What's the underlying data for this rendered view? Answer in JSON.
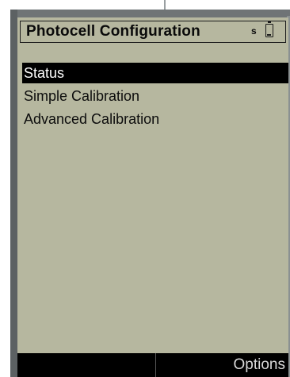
{
  "header": {
    "title": "Photocell Configuration",
    "status_letter": "s",
    "battery_icon": "battery-icon"
  },
  "menu": {
    "items": [
      {
        "label": "Status",
        "selected": true
      },
      {
        "label": "Simple Calibration",
        "selected": false
      },
      {
        "label": "Advanced Calibration",
        "selected": false
      }
    ]
  },
  "softkeys": {
    "left": "",
    "right": "Options"
  },
  "colors": {
    "screen_background": "#b6b79f",
    "selection_background": "#000000",
    "selection_text": "#ffffff",
    "softkey_bar": "#000000",
    "softkey_text": "#d9d9d9"
  }
}
